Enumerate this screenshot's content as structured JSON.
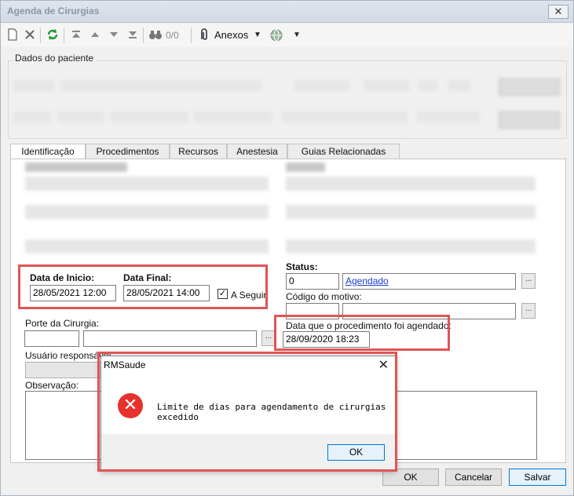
{
  "window": {
    "title": "Agenda de Cirurgias",
    "close_glyph": "✕"
  },
  "toolbar": {
    "icons": [
      "new-document-icon",
      "delete-icon",
      "refresh-icon",
      "first-record-icon",
      "previous-record-icon",
      "next-record-icon",
      "last-record-icon",
      "binoculars-icon",
      "paperclip-icon",
      "globe-icon"
    ],
    "counter": "0/0",
    "attachments_label": "Anexos"
  },
  "patient_group": {
    "label": "Dados do paciente"
  },
  "tabs": [
    {
      "label": "Identificação",
      "active": true
    },
    {
      "label": "Procedimentos",
      "active": false
    },
    {
      "label": "Recursos",
      "active": false
    },
    {
      "label": "Anestesia",
      "active": false
    },
    {
      "label": "Guias Relacionadas",
      "active": false
    }
  ],
  "schedule": {
    "start_label": "Data de Inicio:",
    "start_value": "28/05/2021 12:00",
    "end_label": "Data Final:",
    "end_value": "28/05/2021 14:00",
    "follow_label": "A Seguir",
    "follow_checked": true
  },
  "status": {
    "label": "Status:",
    "code": "0",
    "value": "Agendado",
    "reason_label": "Código do motivo:",
    "scheduled_date_label": "Data que o procedimento foi agendado:",
    "scheduled_date_value": "28/09/2020 18:23"
  },
  "surgery": {
    "size_label": "Porte da Cirurgia:",
    "responsible_label": "Usuário responsável",
    "observation_label": "Observação:"
  },
  "buttons": {
    "ok": "OK",
    "cancel": "Cancelar",
    "save": "Salvar",
    "dots": "..."
  },
  "dialog": {
    "title": "RMSaude",
    "close_glyph": "✕",
    "icon": "error-icon",
    "message": "Limite de dias para agendamento de cirurgias excedido",
    "ok": "OK"
  },
  "colors": {
    "highlight_box": "#e05555",
    "link": "#1a3cc8",
    "error": "#e8312b"
  }
}
